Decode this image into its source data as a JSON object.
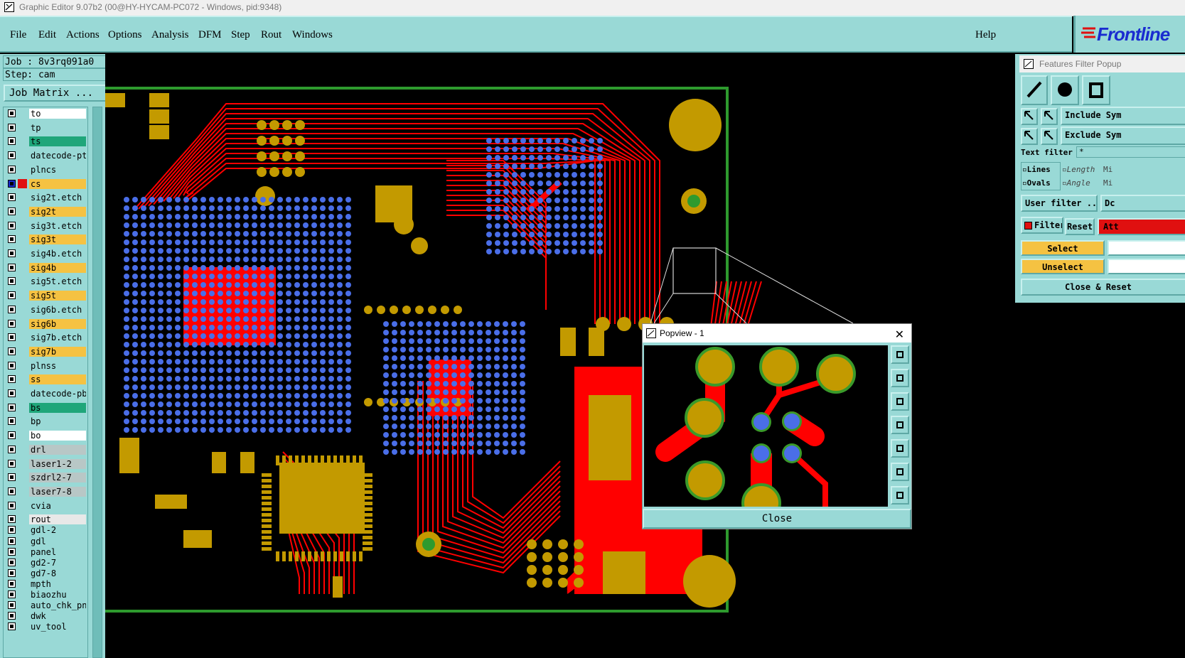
{
  "window": {
    "title": "Graphic Editor 9.07b2 (00@HY-HYCAM-PC072 - Windows, pid:9348)"
  },
  "menu": {
    "file": "File",
    "edit": "Edit",
    "actions": "Actions",
    "options": "Options",
    "analysis": "Analysis",
    "dfm": "DFM",
    "step": "Step",
    "rout": "Rout",
    "windows": "Windows",
    "help": "Help"
  },
  "logo": {
    "text": "Frontline"
  },
  "job": {
    "job_line": "Job : 8v3rq091a0",
    "step_line": "Step: cam",
    "matrix_button": "Job Matrix ..."
  },
  "layers": [
    {
      "name": "to",
      "color": "#ffffff"
    },
    {
      "name": "tp",
      "color": "#99d9d6"
    },
    {
      "name": "ts",
      "color": "#1fa67a"
    },
    {
      "name": "datecode-pt",
      "color": "#99d9d6"
    },
    {
      "name": "plncs",
      "color": "#99d9d6"
    },
    {
      "name": "cs",
      "color": "#f5c242",
      "active": true
    },
    {
      "name": "sig2t.etch",
      "color": "#99d9d6"
    },
    {
      "name": "sig2t",
      "color": "#f5c242"
    },
    {
      "name": "sig3t.etch",
      "color": "#99d9d6"
    },
    {
      "name": "sig3t",
      "color": "#f5c242"
    },
    {
      "name": "sig4b.etch",
      "color": "#99d9d6"
    },
    {
      "name": "sig4b",
      "color": "#f5c242"
    },
    {
      "name": "sig5t.etch",
      "color": "#99d9d6"
    },
    {
      "name": "sig5t",
      "color": "#f5c242"
    },
    {
      "name": "sig6b.etch",
      "color": "#99d9d6"
    },
    {
      "name": "sig6b",
      "color": "#f5c242"
    },
    {
      "name": "sig7b.etch",
      "color": "#99d9d6"
    },
    {
      "name": "sig7b",
      "color": "#f5c242"
    },
    {
      "name": "plnss",
      "color": "#99d9d6"
    },
    {
      "name": "ss",
      "color": "#f5c242"
    },
    {
      "name": "datecode-pb",
      "color": "#99d9d6"
    },
    {
      "name": "bs",
      "color": "#1fa67a"
    },
    {
      "name": "bp",
      "color": "#99d9d6"
    },
    {
      "name": "bo",
      "color": "#ffffff"
    },
    {
      "name": "drl",
      "color": "#b8c7c6"
    },
    {
      "name": "laser1-2",
      "color": "#b8c7c6"
    },
    {
      "name": "szdrl2-7",
      "color": "#b8c7c6"
    },
    {
      "name": "laser7-8",
      "color": "#b8c7c6"
    },
    {
      "name": "cvia",
      "color": "#99d9d6"
    },
    {
      "name": "rout",
      "color": "#e8e8e8"
    },
    {
      "name": "gdl-2",
      "color": "#99d9d6"
    },
    {
      "name": "gdl",
      "color": "#99d9d6"
    },
    {
      "name": "panel",
      "color": "#99d9d6"
    },
    {
      "name": "gd2-7",
      "color": "#99d9d6"
    },
    {
      "name": "gd7-8",
      "color": "#99d9d6"
    },
    {
      "name": "mpth",
      "color": "#99d9d6"
    },
    {
      "name": "biaozhu",
      "color": "#99d9d6"
    },
    {
      "name": "auto_chk_pn",
      "color": "#99d9d6"
    },
    {
      "name": "dwk",
      "color": "#99d9d6"
    },
    {
      "name": "uv_tool",
      "color": "#99d9d6"
    }
  ],
  "features_filter": {
    "title": "Features Filter Popup",
    "include": "Include Sym",
    "exclude": "Exclude Sym",
    "text_filter_label": "Text filter",
    "text_filter_value": "*",
    "lines": "Lines",
    "ovals": "Ovals",
    "length": "Length",
    "min1": "Mi",
    "angle": "Angle",
    "min2": "Mi",
    "user_filter": "User filter ...",
    "dc": "Dc",
    "filter": "Filter",
    "reset": "Reset",
    "attr": "Att",
    "select": "Select",
    "unselect": "Unselect",
    "close_reset": "Close & Reset"
  },
  "popview": {
    "title": "Popview - 1",
    "close": "Close"
  },
  "colors": {
    "trace": "#ff0000",
    "pad": "#c39a00",
    "via": "#4a6ee8",
    "board_edge": "#2e9a2e",
    "panel": "#99d9d6"
  }
}
